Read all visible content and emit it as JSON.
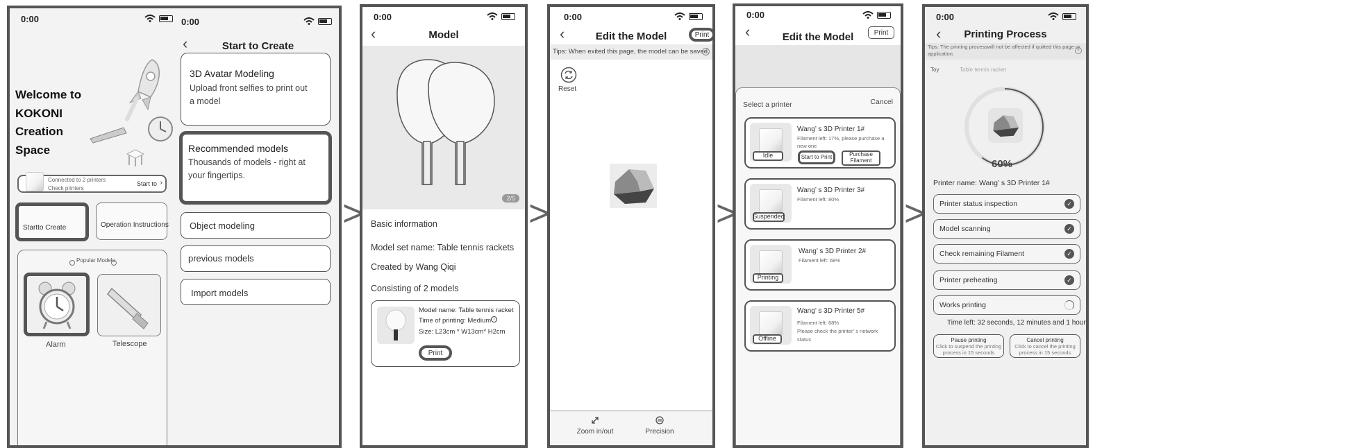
{
  "screen1": {
    "time": "0:00",
    "welcome": [
      "Welcome to",
      "KOKONI",
      "Creation",
      "Space"
    ],
    "connected": "Connected to 2 printers",
    "check": "Check printers",
    "start_to": "Start to",
    "start_create": "Startto Create",
    "operation": "Operation Instructions",
    "popular": "Popular Models",
    "alarm": "Alarm",
    "telescope": "Telescope"
  },
  "screen2": {
    "time": "0:00",
    "title": "Start to Create",
    "cards": [
      {
        "title": "3D Avatar Modeling",
        "desc": [
          "Upload front selfies to print out",
          "a model"
        ]
      },
      {
        "title": "Recommended models",
        "desc": [
          "Thousands of models - right at",
          "your fingertips."
        ]
      }
    ],
    "options": [
      "Object modeling",
      "previous models",
      "Import models"
    ]
  },
  "screen3": {
    "time": "0:00",
    "title": "Model",
    "page_indicator": "2/5",
    "basic_info": "Basic information",
    "set_name": "Model set name: Table tennis rackets",
    "created_by": "Created by Wang Qiqi",
    "consisting": "Consisting of 2 models",
    "model_name": "Model name: Table tennis racket",
    "time_print": "Time of printing: Medium",
    "size": "Size: L23cm * W13cm* H2cm",
    "print": "Print"
  },
  "screen4": {
    "time": "0:00",
    "title": "Edit the Model",
    "print": "Print",
    "tips": "Tips: When exited this page, the model can be saved.",
    "reset": "Reset",
    "zoom": "Zoom in/out",
    "precision": "Precision"
  },
  "screen5": {
    "time": "0:00",
    "title": "Edit the Model",
    "print": "Print",
    "select": "Select a printer",
    "cancel": "Cancel",
    "printers": [
      {
        "name": "Wang’ s 3D Printer 1#",
        "info": [
          "Filament left: 17%, please purchase a",
          "new one"
        ],
        "status": "Idle",
        "btn1": "Start to Print",
        "btn2": "Purchase Filament"
      },
      {
        "name": "Wang’ s 3D Printer 3#",
        "info": [
          "Filament left: 80%"
        ],
        "status": "Suspended"
      },
      {
        "name": "Wang’ s 3D Printer 2#",
        "info": [
          "Filament left: 68%"
        ],
        "status": "Printing"
      },
      {
        "name": "Wang’ s 3D Printer 5#",
        "info": [
          "Filament left: 68%",
          "Please check the printer’ s network",
          "status"
        ],
        "status": "Offline"
      }
    ]
  },
  "screen6": {
    "time": "0:00",
    "title": "Printing Process",
    "tips": [
      "Tips: The printing processwill not be affected if quitted this page or",
      "application."
    ],
    "toy_label": "Toy",
    "toy_value": "Table tennis racket",
    "progress": "60%",
    "progress_value": 0.6,
    "printer_name": "Printer name: Wang’ s 3D Printer 1#",
    "steps": [
      "Printer status inspection",
      "Model scanning",
      "Check remaining Filament",
      "Printer preheating",
      "Works printing"
    ],
    "time_left": "Time left: 32 seconds, 12 minutes and 1 hour",
    "pause": "Pause printing",
    "pause_desc": [
      "Click to suspend the printing",
      "process in 15 seconds"
    ],
    "cancel": "Cancel printing",
    "cancel_desc": [
      "Click to cancel the printing",
      "process in 15 seconds"
    ]
  },
  "separators": [
    ">",
    ">",
    ">",
    ">"
  ]
}
